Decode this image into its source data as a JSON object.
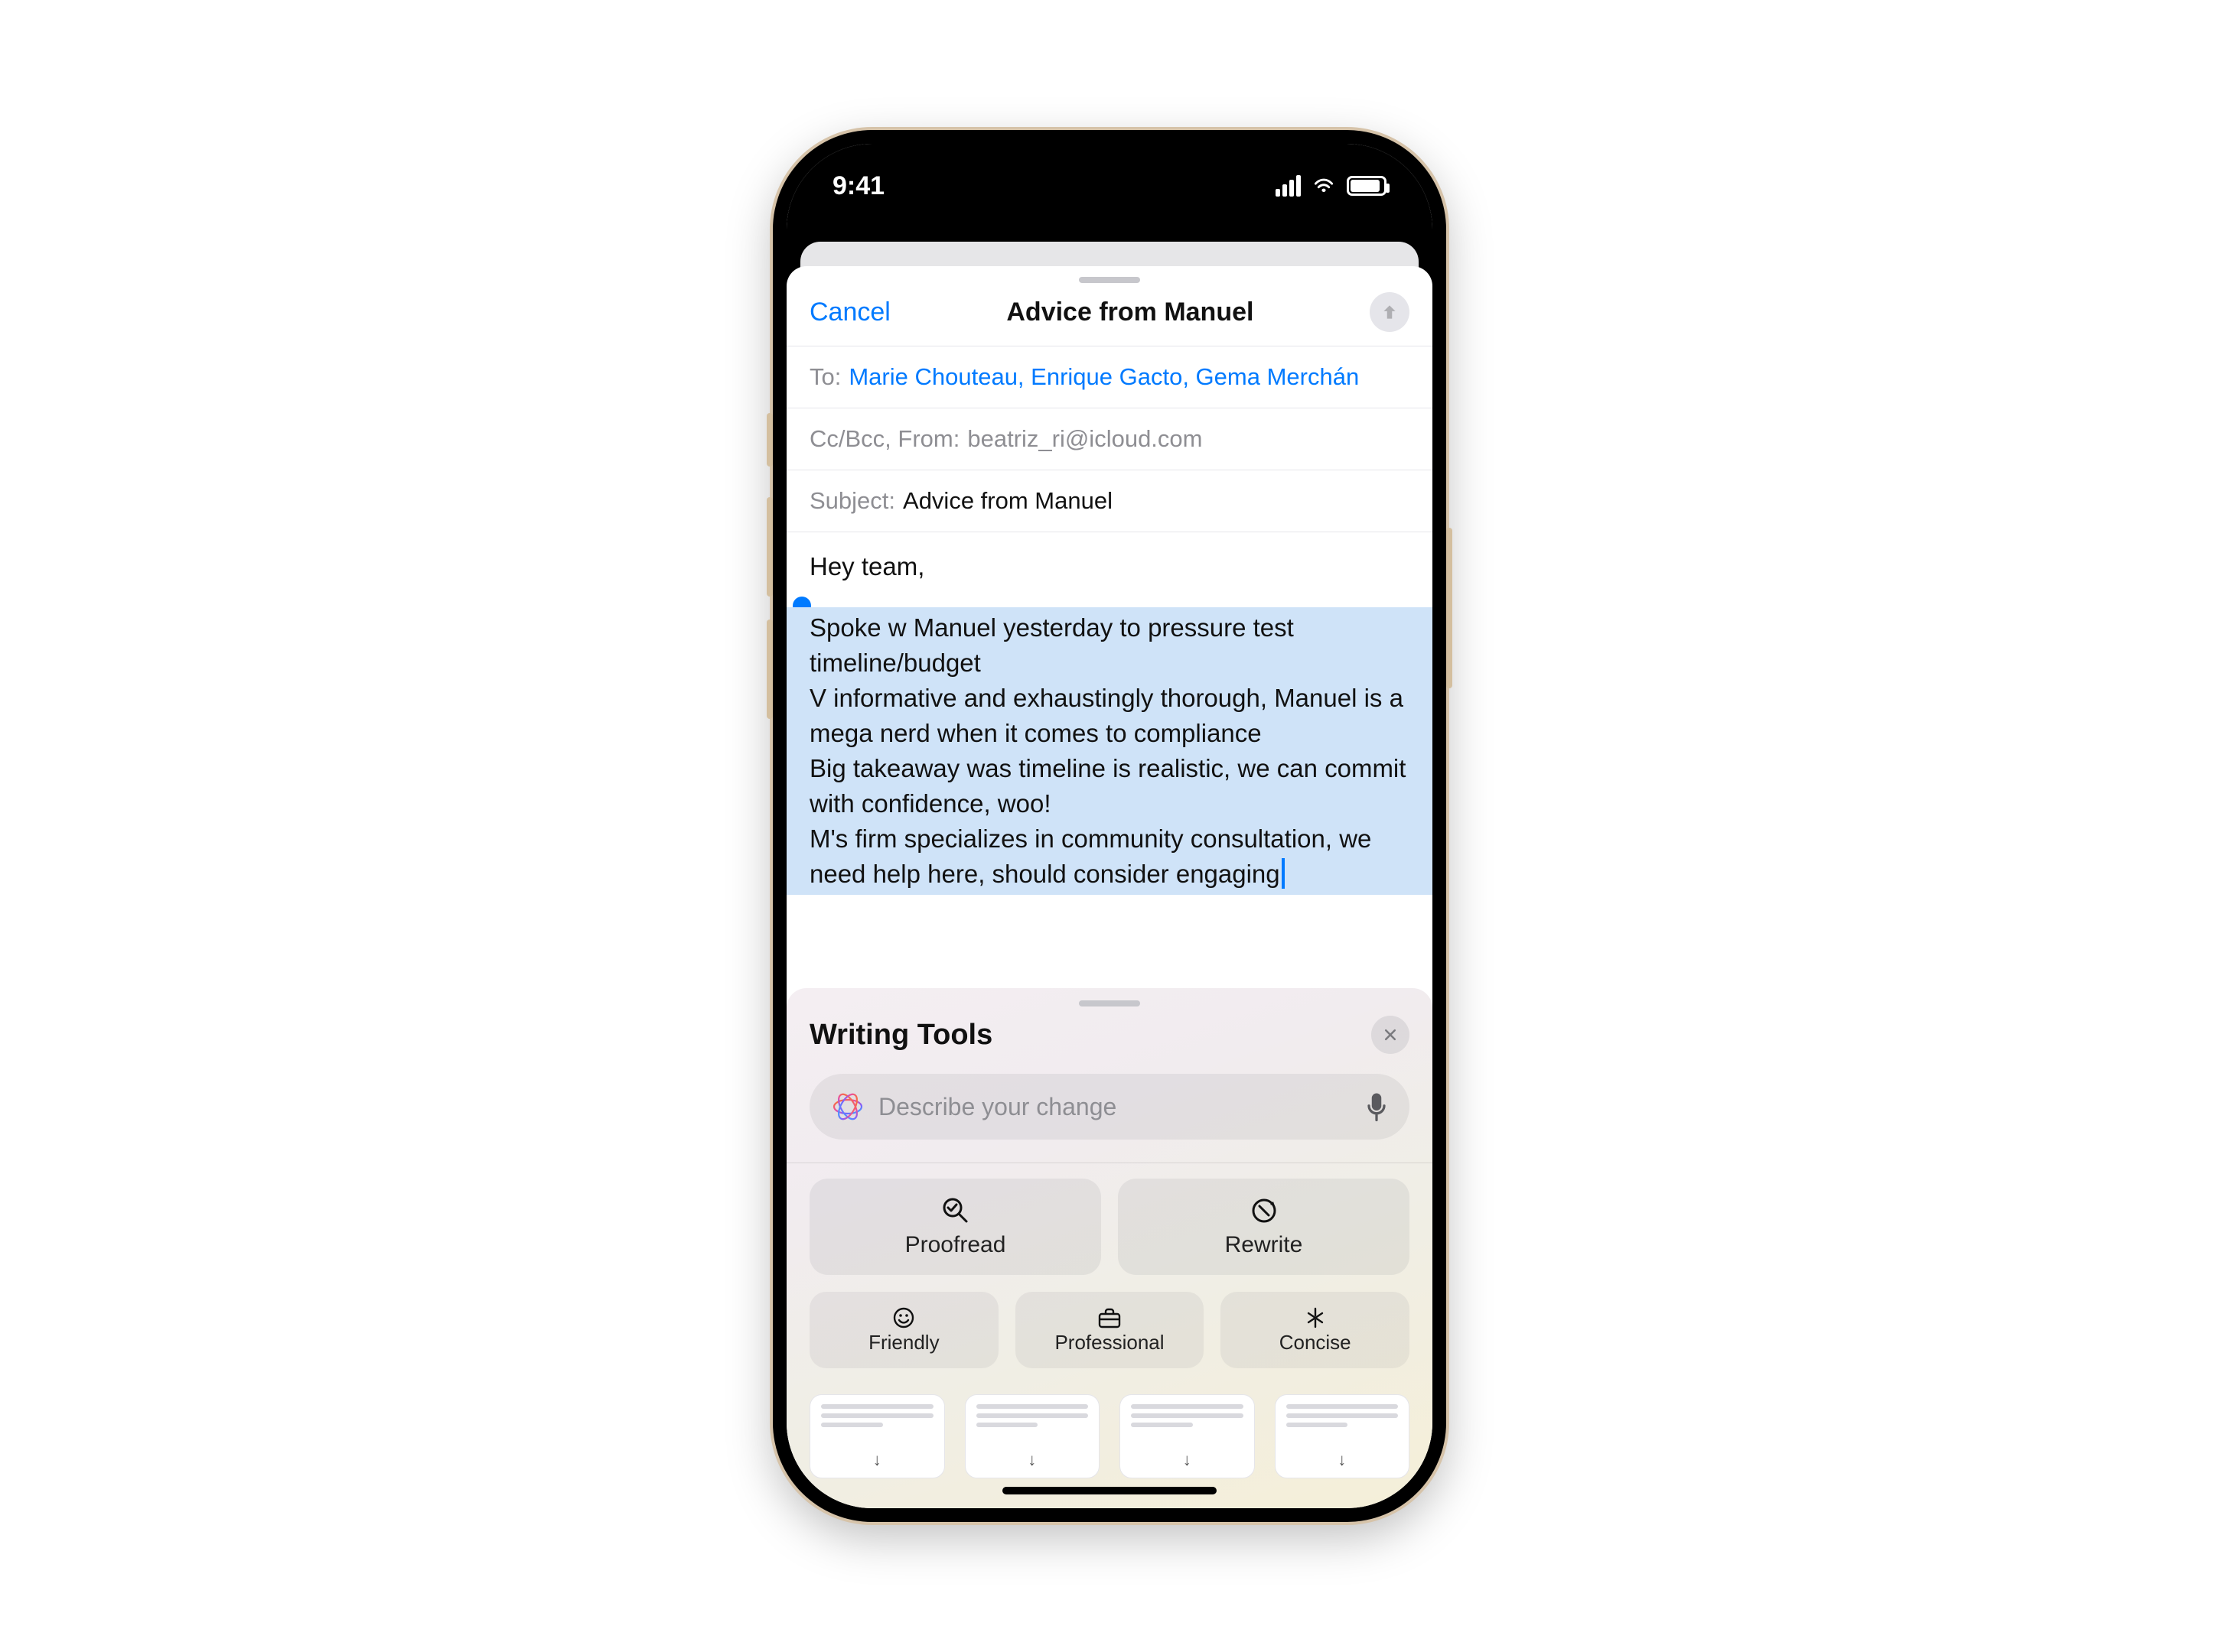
{
  "status": {
    "time": "9:41"
  },
  "compose": {
    "cancel": "Cancel",
    "title": "Advice from Manuel",
    "to_label": "To:",
    "to_value": "Marie Chouteau, Enrique Gacto, Gema Merchán",
    "ccbcc_label": "Cc/Bcc, From:",
    "from_value": "beatriz_ri@icloud.com",
    "subject_label": "Subject:",
    "subject_value": "Advice from Manuel",
    "greeting": "Hey team,",
    "selected_body": "Spoke w Manuel yesterday to pressure test timeline/budget\nV informative and exhaustingly thorough, Manuel is a mega nerd when it comes to compliance\nBig takeaway was timeline is realistic, we can commit with confidence, woo!\nM's firm specializes in community consultation, we need help here, should consider engaging"
  },
  "tools": {
    "title": "Writing Tools",
    "placeholder": "Describe your change",
    "proofread": "Proofread",
    "rewrite": "Rewrite",
    "friendly": "Friendly",
    "professional": "Professional",
    "concise": "Concise"
  }
}
